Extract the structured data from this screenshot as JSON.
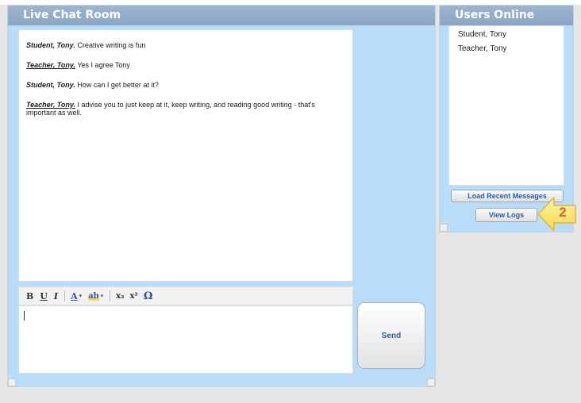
{
  "chat": {
    "title": "Live Chat Room",
    "messages": [
      {
        "sender": "Student, Tony.",
        "role": "student",
        "text": "Creative writing is fun"
      },
      {
        "sender": "Teacher, Tony.",
        "role": "teacher",
        "text": "Yes I agree Tony"
      },
      {
        "sender": "Student, Tony.",
        "role": "student",
        "text": "How can I get better at it?"
      },
      {
        "sender": "Teacher, Tony.",
        "role": "teacher",
        "text": "I advise you to just keep at it, keep writing, and reading good writing - that's important as well."
      }
    ],
    "toolbar": {
      "bold": "B",
      "underline": "U",
      "italic": "I",
      "font_color": "A",
      "highlight": "ab",
      "subscript": "x₂",
      "superscript": "x²",
      "special_char": "Ω"
    },
    "send_label": "Send"
  },
  "users": {
    "title": "Users Online",
    "list": [
      "Student, Tony",
      "Teacher, Tony"
    ],
    "load_recent_label": "Load Recent Messages",
    "view_logs_label": "View Logs"
  },
  "callout": {
    "number": "2",
    "color": "#f6e05e"
  },
  "colors": {
    "panel_bg": "#b9dcf8",
    "header": "#8fa9c5",
    "button_text": "#2d5a9e"
  }
}
